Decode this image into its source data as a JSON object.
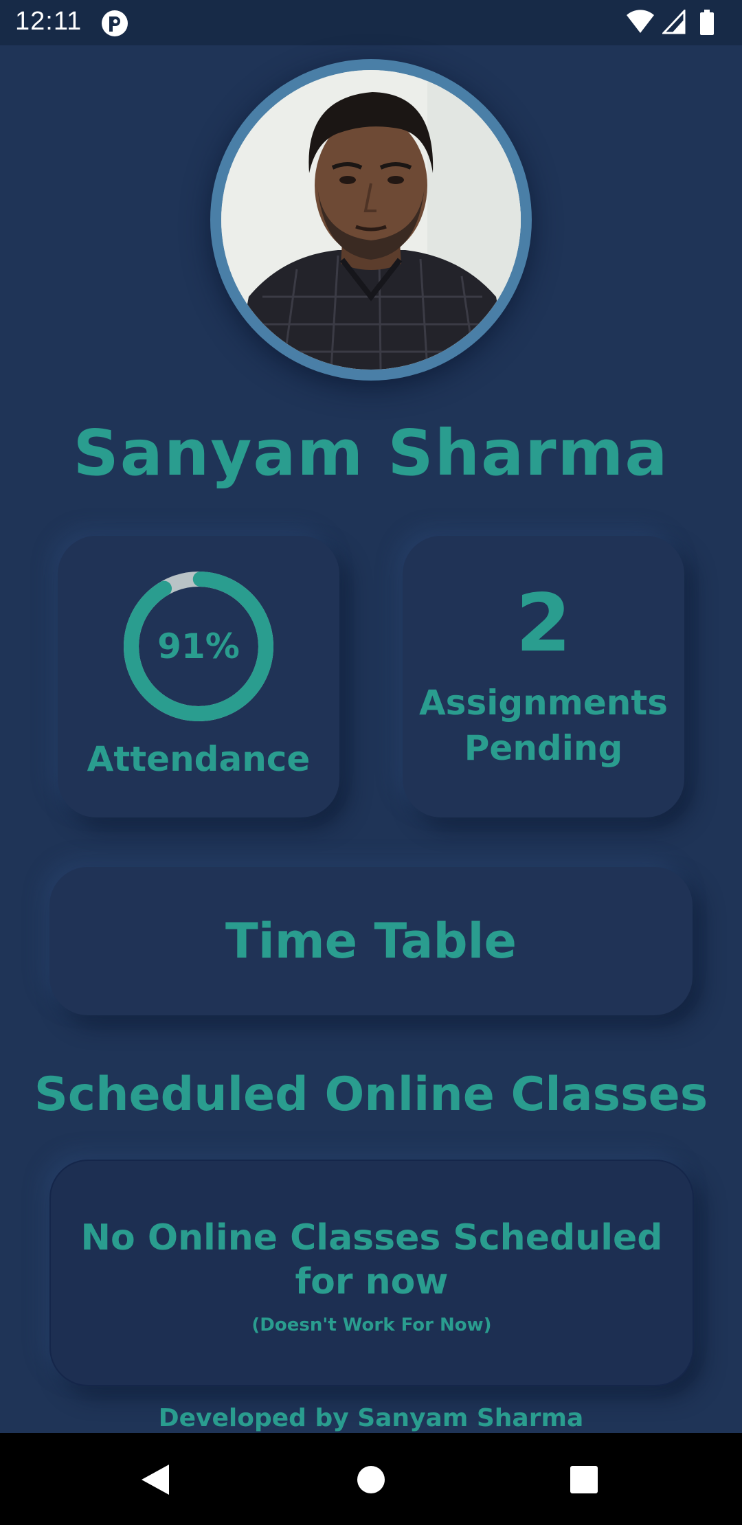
{
  "status_bar": {
    "time": "12:11",
    "icons": [
      "app-notification-icon",
      "wifi-icon",
      "cellular-signal-icon",
      "battery-icon"
    ]
  },
  "profile": {
    "name": "Sanyam Sharma",
    "avatar": "profile-photo"
  },
  "attendance": {
    "percent_text": "91%",
    "percent_value": 91,
    "label": "Attendance"
  },
  "assignments": {
    "count": "2",
    "label_line1": "Assignments",
    "label_line2": "Pending"
  },
  "timetable": {
    "label": "Time Table"
  },
  "online_classes": {
    "section_title": "Scheduled Online Classes",
    "message_line1": "No Online Classes Scheduled",
    "message_line2": "for now",
    "note": "(Doesn't Work For Now)"
  },
  "footer": {
    "credit": "Developed by Sanyam Sharma"
  },
  "colors": {
    "background": "#1f3457",
    "card": "#203356",
    "accent": "#2a9d8f",
    "ring_track": "#b9c3c6",
    "avatar_border": "#4a7fa7"
  },
  "nav_bar": {
    "icons": [
      "back-icon",
      "home-icon",
      "recents-icon"
    ]
  }
}
